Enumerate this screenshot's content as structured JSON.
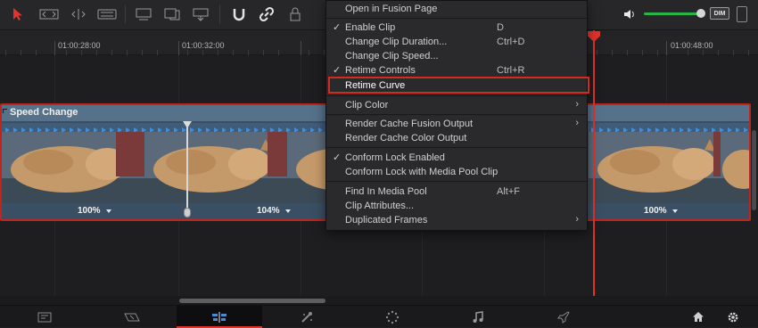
{
  "ruler": {
    "timecodes": [
      "01:00:28:00",
      "01:00:32:00",
      "01:00:48:00"
    ]
  },
  "clip": {
    "title": "Speed Change",
    "speed_labels": [
      "100%",
      "104%",
      "100%"
    ],
    "border_color": "#c2231b"
  },
  "context_menu": {
    "items": [
      {
        "label": "Open in Fusion Page",
        "shortcut": "",
        "checked": false,
        "submenu": false
      },
      {
        "label": "Enable Clip",
        "shortcut": "D",
        "checked": true,
        "submenu": false
      },
      {
        "label": "Change Clip Duration...",
        "shortcut": "Ctrl+D",
        "checked": false,
        "submenu": false
      },
      {
        "label": "Change Clip Speed...",
        "shortcut": "",
        "checked": false,
        "submenu": false
      },
      {
        "label": "Retime Controls",
        "shortcut": "Ctrl+R",
        "checked": true,
        "submenu": false
      },
      {
        "label": "Retime Curve",
        "shortcut": "",
        "checked": false,
        "submenu": false,
        "highlighted": true
      },
      {
        "label": "Clip Color",
        "shortcut": "",
        "checked": false,
        "submenu": true
      },
      {
        "label": "Render Cache Fusion Output",
        "shortcut": "",
        "checked": false,
        "submenu": true
      },
      {
        "label": "Render Cache Color Output",
        "shortcut": "",
        "checked": false,
        "submenu": false
      },
      {
        "label": "Conform Lock Enabled",
        "shortcut": "",
        "checked": true,
        "submenu": false
      },
      {
        "label": "Conform Lock with Media Pool Clip",
        "shortcut": "",
        "checked": false,
        "submenu": false
      },
      {
        "label": "Find In Media Pool",
        "shortcut": "Alt+F",
        "checked": false,
        "submenu": false
      },
      {
        "label": "Clip Attributes...",
        "shortcut": "",
        "checked": false,
        "submenu": false
      },
      {
        "label": "Duplicated Frames",
        "shortcut": "",
        "checked": false,
        "submenu": true
      }
    ],
    "check_glyph": "✓",
    "submenu_glyph": "›"
  },
  "toolbar": {
    "dim_label": "DIM",
    "volume_level": 0.9,
    "icons": [
      "selection-arrow-icon",
      "trim-icon",
      "dynamic-trim-icon",
      "blade-icon",
      "insert-icon",
      "overwrite-icon",
      "replace-icon",
      "snapping-icon",
      "linked-selection-icon",
      "lock-icon",
      "volume-icon"
    ]
  },
  "bottom_bar": {
    "pages": [
      "media",
      "cut",
      "edit",
      "fusion",
      "color",
      "fairlight",
      "deliver"
    ],
    "active_page": "edit"
  },
  "colors": {
    "accent_red": "#e0342b",
    "clip_blue": "#56718a",
    "volume_green": "#29b44a"
  }
}
